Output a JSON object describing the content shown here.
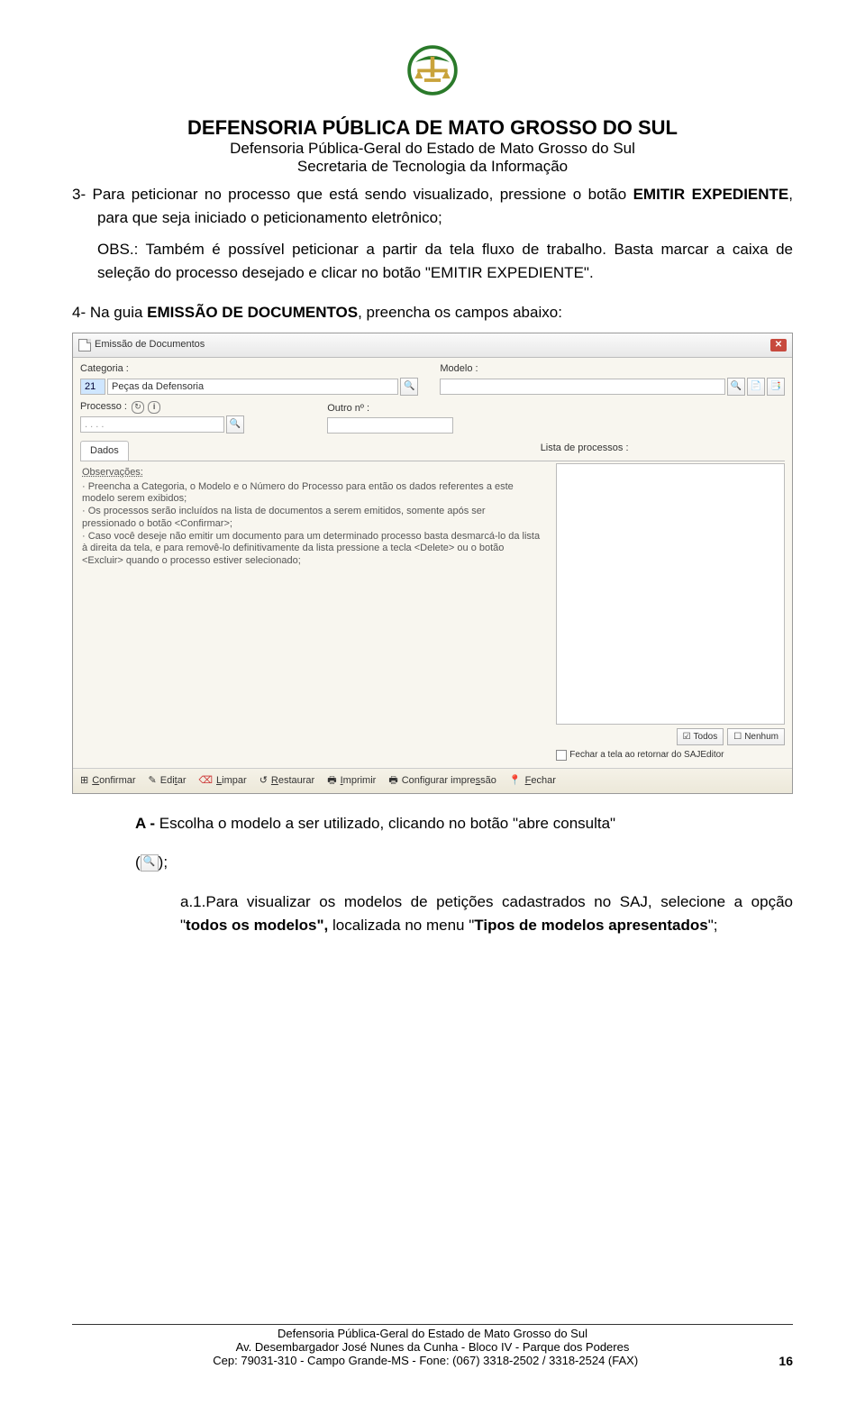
{
  "header": {
    "title": "DEFENSORIA PÚBLICA DE MATO GROSSO DO SUL",
    "sub1": "Defensoria Pública-Geral do Estado de Mato Grosso do Sul",
    "sub2": "Secretaria de Tecnologia da Informação"
  },
  "body": {
    "p3_prefix": "3- ",
    "p3_a": "Para peticionar no processo que está sendo visualizado, pressione o botão ",
    "p3_b": "EMITIR EXPEDIENTE",
    "p3_c": ", para que seja iniciado o peticionamento eletrônico;",
    "obs_a": "OBS.: Também é possível peticionar a partir da tela fluxo de trabalho. Basta marcar a caixa de seleção do processo desejado e clicar no botão \"EMITIR EXPEDIENTE\".",
    "p4_prefix": "4- ",
    "p4_a": "Na guia ",
    "p4_b": "EMISSÃO DE DOCUMENTOS",
    "p4_c": ", preencha os campos abaixo:",
    "A_label": "A - ",
    "A_text": "Escolha o modelo a ser utilizado, clicando no botão \"abre consulta\"",
    "A_paren_open": "(",
    "A_paren_close": ");",
    "a1_label": "a.1.",
    "a1_text_a": "Para visualizar os modelos de petições cadastrados no SAJ, selecione a opção \"",
    "a1_text_b": "todos os modelos\",",
    "a1_text_c": " localizada no menu \"",
    "a1_text_d": "Tipos de modelos apresentados",
    "a1_text_e": "\";"
  },
  "screenshot": {
    "window_title": "Emissão de Documentos",
    "labels": {
      "categoria": "Categoria :",
      "modelo": "Modelo :",
      "processo": "Processo :",
      "outro": "Outro nº :",
      "lista": "Lista de processos :",
      "obs_title": "Observações:"
    },
    "categoria_code": "21",
    "categoria_name": "Peças da Defensoria",
    "processo_mask": ".    .    .    .",
    "tab": "Dados",
    "obs_lines": [
      "· Preencha a Categoria, o Modelo e o Número do Processo para então os dados referentes a este modelo serem exibidos;",
      "· Os processos serão incluídos na lista de documentos a serem emitidos, somente após ser pressionado o botão <Confirmar>;",
      "· Caso você deseje não emitir um documento para um determinado processo basta desmarcá-lo da lista à direita da tela, e para removê-lo definitivamente da lista pressione a tecla <Delete> ou o botão <Excluir> quando o processo estiver selecionado;"
    ],
    "btn_todos": "Todos",
    "btn_nenhum": "Nenhum",
    "check_fechar": "Fechar a tela ao retornar do SAJEditor",
    "toolbar": {
      "confirmar": "Confirmar",
      "editar": "Editar",
      "limpar": "Limpar",
      "restaurar": "Restaurar",
      "imprimir": "Imprimir",
      "config": "Configurar impressão",
      "fechar": "Fechar"
    }
  },
  "footer": {
    "l1": "Defensoria Pública-Geral do Estado de Mato Grosso do Sul",
    "l2": "Av. Desembargador José Nunes da Cunha - Bloco IV - Parque dos Poderes",
    "l3": "Cep: 79031-310 - Campo Grande-MS -  Fone: (067) 3318-2502 / 3318-2524 (FAX)",
    "page": "16"
  }
}
